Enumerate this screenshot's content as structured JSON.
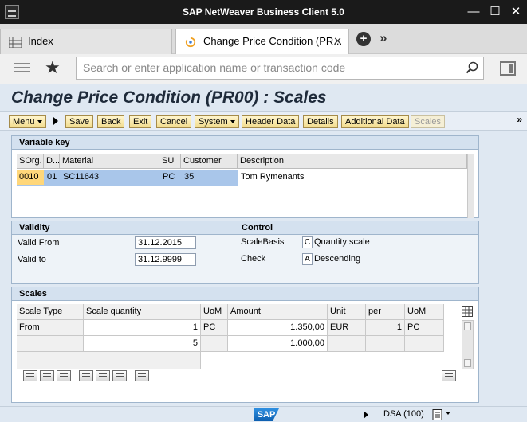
{
  "window": {
    "title": "SAP NetWeaver Business Client 5.0"
  },
  "tabs": [
    {
      "label": "Index"
    },
    {
      "label": "Change Price Condition (PR...",
      "close": "✕"
    }
  ],
  "search": {
    "placeholder": "Search or enter application name or transaction code"
  },
  "page": {
    "title": "Change Price Condition (PR00) : Scales"
  },
  "toolbar": {
    "menu": "Menu",
    "save": "Save",
    "back": "Back",
    "exit": "Exit",
    "cancel": "Cancel",
    "system": "System",
    "header_data": "Header Data",
    "details": "Details",
    "additional_data": "Additional Data",
    "scales": "Scales"
  },
  "variable_key": {
    "title": "Variable key",
    "headers": [
      "SOrg.",
      "D...",
      "Material",
      "SU",
      "Customer",
      "Description"
    ],
    "row": {
      "sorg": "0010",
      "d": "01",
      "material": "SC11643",
      "su": "PC",
      "customer": "35",
      "description": "Tom Rymenants"
    }
  },
  "validity": {
    "title": "Validity",
    "valid_from_label": "Valid From",
    "valid_from": "31.12.2015",
    "valid_to_label": "Valid to",
    "valid_to": "31.12.9999"
  },
  "control": {
    "title": "Control",
    "scale_basis_label": "ScaleBasis",
    "scale_basis_code": "C",
    "scale_basis_text": "Quantity scale",
    "check_label": "Check",
    "check_code": "A",
    "check_text": "Descending"
  },
  "scales": {
    "title": "Scales",
    "headers": [
      "Scale Type",
      "Scale quantity",
      "UoM",
      "Amount",
      "Unit",
      "per",
      "UoM"
    ],
    "rows": [
      {
        "type": "From",
        "qty": "1",
        "uom": "PC",
        "amount": "1.350,00",
        "unit": "EUR",
        "per": "1",
        "uom2": "PC"
      },
      {
        "type": "",
        "qty": "5",
        "uom": "",
        "amount": "1.000,00",
        "unit": "",
        "per": "",
        "uom2": ""
      }
    ]
  },
  "status": {
    "system": "DSA (100)",
    "logo": "SAP"
  },
  "colors": {
    "accent_title": "#1e2a3a",
    "selected_row": "#a9c6ea",
    "highlight_cell": "#ffd77a"
  }
}
